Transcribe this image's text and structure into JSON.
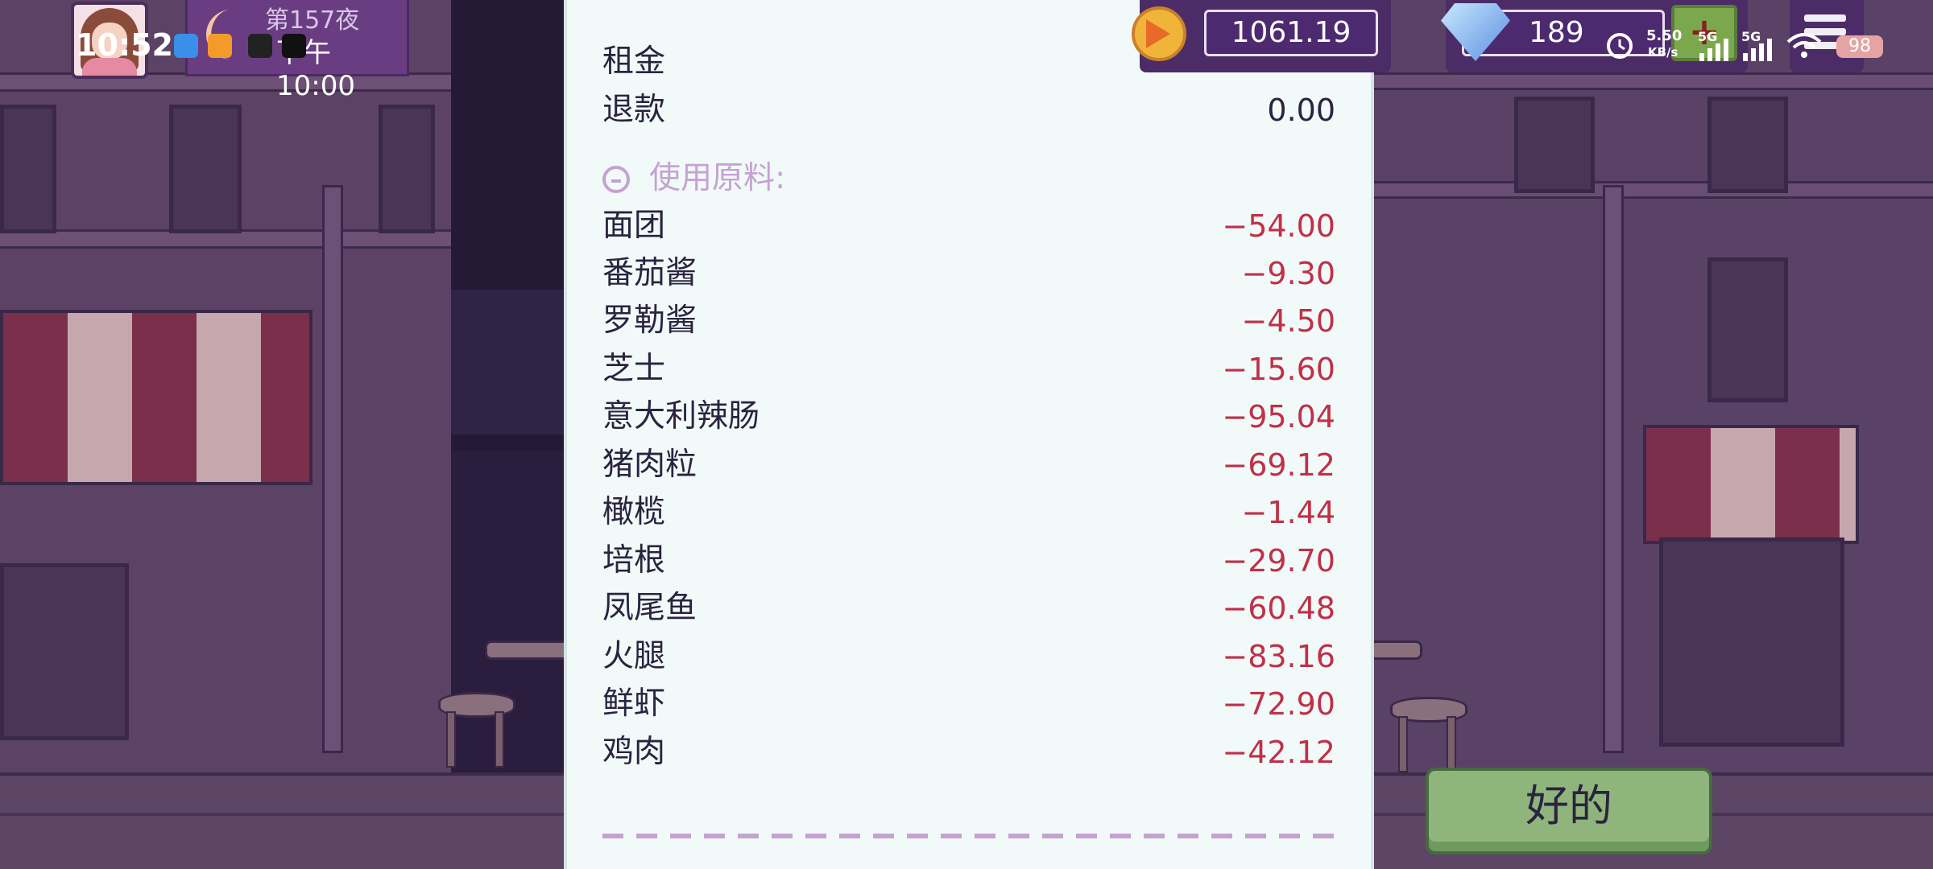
{
  "hud": {
    "day": "第157夜",
    "time": "下午10:00",
    "status_time": "10:52",
    "coins": "1061.19",
    "gems": "189",
    "plus": "+",
    "net_speed": "5.50",
    "net_unit": "KB/s",
    "net_type_1": "5G",
    "net_type_2": "5G",
    "battery": "98"
  },
  "receipt": {
    "top_rows": [
      {
        "label": "租金",
        "value": ""
      },
      {
        "label": "退款",
        "value": "0.00"
      }
    ],
    "section_title": "使用原料:",
    "items": [
      {
        "label": "面团",
        "value": "−54.00"
      },
      {
        "label": "番茄酱",
        "value": "−9.30"
      },
      {
        "label": "罗勒酱",
        "value": "−4.50"
      },
      {
        "label": "芝士",
        "value": "−15.60"
      },
      {
        "label": "意大利辣肠",
        "value": "−95.04"
      },
      {
        "label": "猪肉粒",
        "value": "−69.12"
      },
      {
        "label": "橄榄",
        "value": "−1.44"
      },
      {
        "label": "培根",
        "value": "−29.70"
      },
      {
        "label": "凤尾鱼",
        "value": "−60.48"
      },
      {
        "label": "火腿",
        "value": "−83.16"
      },
      {
        "label": "鲜虾",
        "value": "−72.90"
      },
      {
        "label": "鸡肉",
        "value": "−42.12"
      }
    ]
  },
  "ok_button": "好的",
  "colors": {
    "negative": "#c03048",
    "accent_purple": "#c5a2d2",
    "button_green": "#8fb57c",
    "hud_purple": "#4b2c66"
  }
}
